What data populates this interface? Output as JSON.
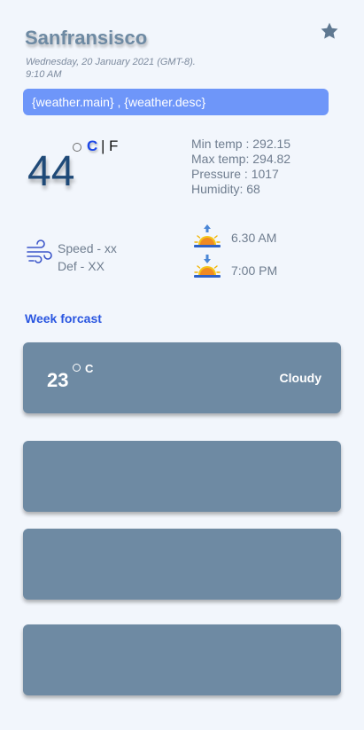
{
  "header": {
    "city": "Sanfransisco",
    "date_line1": "Wednesday, 20 January 2021 (GMT-8).",
    "date_line2": "9:10 AM"
  },
  "banner": {
    "text": "{weather.main} , {weather.desc}"
  },
  "current": {
    "temperature": "44",
    "unit_c": "C",
    "unit_separator": "|",
    "unit_f": "F",
    "min_temp": "Min temp : 292.15",
    "max_temp": "Max temp: 294.82",
    "pressure": "Pressure : 1017",
    "humidity": "Humidity: 68"
  },
  "wind": {
    "speed": "Speed -  xx",
    "def": "Def - XX"
  },
  "sun": {
    "sunrise": "6.30 AM",
    "sunset": "7:00 PM"
  },
  "week": {
    "title": "Week forcast",
    "cards": [
      {
        "temp": "23",
        "unit": "C",
        "condition": "Cloudy"
      },
      {},
      {},
      {}
    ]
  },
  "colors": {
    "background": "#f2f6fc",
    "banner": "#6e96f9",
    "card": "#6e8aa3",
    "accent_blue": "#2a56e0"
  },
  "icons": {
    "favorite": "star-icon",
    "wind": "wind-icon",
    "sunrise": "sunrise-icon",
    "sunset": "sunset-icon"
  }
}
